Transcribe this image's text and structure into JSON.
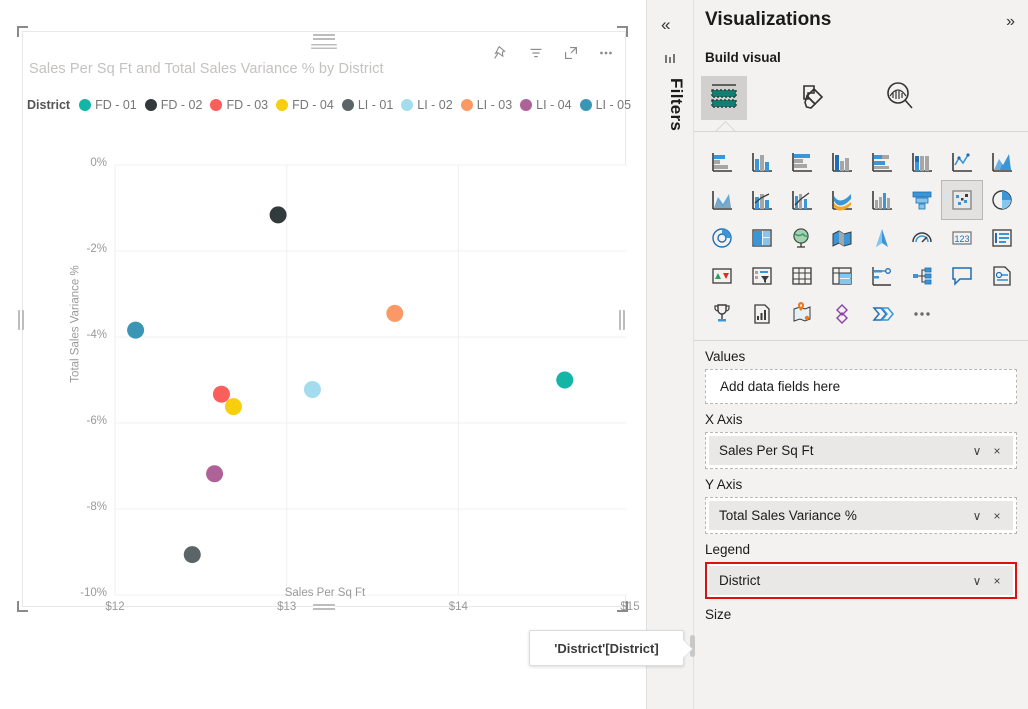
{
  "visual": {
    "title": "Sales Per Sq Ft and Total Sales Variance % by District",
    "tools": [
      {
        "name": "pin-icon",
        "label": "Pin to dashboard"
      },
      {
        "name": "filter-icon",
        "label": "Filters"
      },
      {
        "name": "focus-mode-icon",
        "label": "Focus mode"
      },
      {
        "name": "more-options-icon",
        "label": "More options"
      }
    ]
  },
  "legend": {
    "title": "District",
    "items": [
      {
        "label": "FD - 01",
        "color": "#13b5a5"
      },
      {
        "label": "FD - 02",
        "color": "#333a3c"
      },
      {
        "label": "FD - 03",
        "color": "#fc5e5b"
      },
      {
        "label": "FD - 04",
        "color": "#f7cf0d"
      },
      {
        "label": "LI - 01",
        "color": "#5b6567"
      },
      {
        "label": "LI - 02",
        "color": "#a2dcee"
      },
      {
        "label": "LI - 03",
        "color": "#fb9966"
      },
      {
        "label": "LI - 04",
        "color": "#ae6297"
      },
      {
        "label": "LI - 05",
        "color": "#3a96b4"
      }
    ]
  },
  "chart_data": {
    "type": "scatter",
    "title": "Sales Per Sq Ft and Total Sales Variance % by District",
    "xlabel": "Sales Per Sq Ft",
    "ylabel": "Total Sales Variance %",
    "xlim": [
      12,
      15
    ],
    "ylim": [
      -10,
      0
    ],
    "xticks": [
      "$12",
      "$13",
      "$14",
      "$15"
    ],
    "xtick_values": [
      12,
      13,
      14,
      15
    ],
    "yticks": [
      "0%",
      "-2%",
      "-4%",
      "-6%",
      "-8%",
      "-10%"
    ],
    "ytick_values": [
      0,
      -2,
      -4,
      -6,
      -8,
      -10
    ],
    "grid": true,
    "legend_position": "top",
    "points": [
      {
        "series": "FD - 01",
        "x": 14.62,
        "y": -5.0,
        "color": "#13b5a5"
      },
      {
        "series": "FD - 02",
        "x": 12.95,
        "y": -1.16,
        "color": "#333a3c"
      },
      {
        "series": "FD - 03",
        "x": 12.62,
        "y": -5.33,
        "color": "#fc5e5b"
      },
      {
        "series": "FD - 04",
        "x": 12.69,
        "y": -5.62,
        "color": "#f7cf0d"
      },
      {
        "series": "LI - 01",
        "x": 12.45,
        "y": -9.06,
        "color": "#5b6567"
      },
      {
        "series": "LI - 02",
        "x": 13.15,
        "y": -5.22,
        "color": "#a2dcee"
      },
      {
        "series": "LI - 03",
        "x": 13.63,
        "y": -3.45,
        "color": "#fb9966"
      },
      {
        "series": "LI - 04",
        "x": 12.58,
        "y": -7.18,
        "color": "#ae6297"
      },
      {
        "series": "LI - 05",
        "x": 12.12,
        "y": -3.84,
        "color": "#3a96b4"
      }
    ]
  },
  "tooltip": {
    "text": "'District'[District]"
  },
  "filters_rail": {
    "collapse_label": "«",
    "title": "Filters"
  },
  "viz_pane": {
    "title": "Visualizations",
    "expand_label": "»",
    "build_label": "Build visual",
    "tabs": [
      {
        "name": "build-visual-tab",
        "icon": "fields-icon",
        "selected": true
      },
      {
        "name": "format-visual-tab",
        "icon": "paint-roller-icon",
        "selected": false
      },
      {
        "name": "analytics-tab",
        "icon": "magnifier-chart-icon",
        "selected": false
      }
    ],
    "visual_types": [
      {
        "name": "stacked-bar-chart",
        "selected": false
      },
      {
        "name": "stacked-column-chart",
        "selected": false
      },
      {
        "name": "clustered-bar-chart",
        "selected": false
      },
      {
        "name": "clustered-column-chart",
        "selected": false
      },
      {
        "name": "100-percent-stacked-bar-chart",
        "selected": false
      },
      {
        "name": "100-percent-stacked-column-chart",
        "selected": false
      },
      {
        "name": "line-chart",
        "selected": false
      },
      {
        "name": "area-chart",
        "selected": false
      },
      {
        "name": "stacked-area-chart",
        "selected": false
      },
      {
        "name": "line-and-stacked-column-chart",
        "selected": false
      },
      {
        "name": "line-and-clustered-column-chart",
        "selected": false
      },
      {
        "name": "ribbon-chart",
        "selected": false
      },
      {
        "name": "waterfall-chart",
        "selected": false
      },
      {
        "name": "funnel-chart",
        "selected": false
      },
      {
        "name": "scatter-chart",
        "selected": true
      },
      {
        "name": "pie-chart",
        "selected": false
      },
      {
        "name": "donut-chart",
        "selected": false
      },
      {
        "name": "treemap",
        "selected": false
      },
      {
        "name": "map",
        "selected": false
      },
      {
        "name": "filled-map",
        "selected": false
      },
      {
        "name": "azure-map",
        "selected": false
      },
      {
        "name": "gauge",
        "selected": false
      },
      {
        "name": "card",
        "selected": false
      },
      {
        "name": "multi-row-card",
        "selected": false
      },
      {
        "name": "kpi",
        "selected": false
      },
      {
        "name": "slicer",
        "selected": false
      },
      {
        "name": "table",
        "selected": false
      },
      {
        "name": "matrix",
        "selected": false
      },
      {
        "name": "decomposition-tree",
        "selected": false
      },
      {
        "name": "key-influencers",
        "selected": false
      },
      {
        "name": "qna",
        "selected": false
      },
      {
        "name": "smart-narrative",
        "selected": false
      },
      {
        "name": "paginated-report",
        "selected": false
      },
      {
        "name": "r-script-visual",
        "selected": false
      },
      {
        "name": "arcgis-map",
        "selected": false
      },
      {
        "name": "python-visual",
        "selected": false
      },
      {
        "name": "power-automate",
        "selected": false
      },
      {
        "name": "more-visuals",
        "selected": false
      }
    ],
    "wells": [
      {
        "label": "Values",
        "placeholder": "Add data fields here",
        "field": null,
        "highlight": false
      },
      {
        "label": "X Axis",
        "placeholder": "",
        "field": "Sales Per Sq Ft",
        "highlight": false
      },
      {
        "label": "Y Axis",
        "placeholder": "",
        "field": "Total Sales Variance %",
        "highlight": false
      },
      {
        "label": "Legend",
        "placeholder": "",
        "field": "District",
        "highlight": true
      },
      {
        "label": "Size",
        "placeholder": "",
        "field": null,
        "highlight": false
      }
    ],
    "chip_buttons": {
      "dropdown": "∨",
      "remove": "×"
    },
    "highlight_color": "#e01010"
  }
}
